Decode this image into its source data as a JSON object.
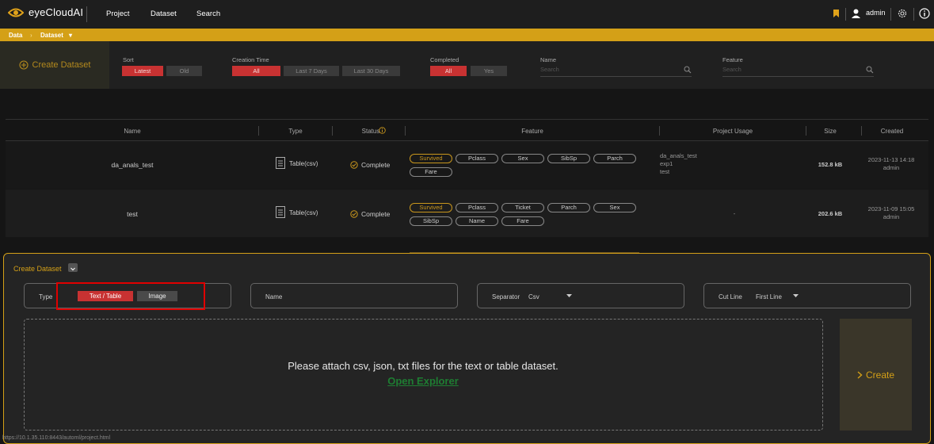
{
  "app": {
    "name": "eyeCloudAI"
  },
  "nav": {
    "project": "Project",
    "dataset": "Dataset",
    "search": "Search"
  },
  "user": {
    "name": "admin"
  },
  "breadcrumb": {
    "data": "Data",
    "sep": "›",
    "dataset": "Dataset",
    "caret": "▾"
  },
  "filters": {
    "create_label": "Create Dataset",
    "sort": {
      "label": "Sort",
      "options": [
        "Latest",
        "Old"
      ],
      "selected": "Latest"
    },
    "creation_time": {
      "label": "Creation Time",
      "options": [
        "All",
        "Last 7 Days",
        "Last 30 Days"
      ],
      "selected": "All"
    },
    "completed": {
      "label": "Completed",
      "options": [
        "All",
        "Yes"
      ],
      "selected": "All"
    },
    "name": {
      "label": "Name",
      "placeholder": "Search"
    },
    "feature": {
      "label": "Feature",
      "placeholder": "Search"
    }
  },
  "table": {
    "headers": [
      "Name",
      "Type",
      "Status",
      "Feature",
      "Project Usage",
      "Size",
      "Created"
    ],
    "rows": [
      {
        "name": "da_anals_test",
        "type": "Table(csv)",
        "status": "Complete",
        "features": [
          "Survived",
          "Pclass",
          "Sex",
          "SibSp",
          "Parch",
          "Fare"
        ],
        "target": "Survived",
        "usage": [
          "da_anals_test",
          "exp1",
          "test"
        ],
        "size": "152.8 kB",
        "created_date": "2023-11-13 14:18",
        "created_by": "admin"
      },
      {
        "name": "test",
        "type": "Table(csv)",
        "status": "Complete",
        "features": [
          "Survived",
          "Pclass",
          "Ticket",
          "Parch",
          "Sex",
          "SibSp",
          "Name",
          "Fare"
        ],
        "target": "Survived",
        "usage": [
          "-"
        ],
        "size": "202.6 kB",
        "created_date": "2023-11-09 15:05",
        "created_by": "admin"
      }
    ]
  },
  "panel": {
    "title": "Create Dataset",
    "type_label": "Type",
    "type_options": [
      "Text / Table",
      "Image"
    ],
    "type_selected": "Text / Table",
    "name_label": "Name",
    "separator_label": "Separator",
    "separator_value": "Csv",
    "cutline_label": "Cut Line",
    "cutline_value": "First Line",
    "drop_text": "Please attach csv, json, txt files for the text or table dataset.",
    "open_explorer": "Open Explorer",
    "create_button": "Create"
  },
  "status_url": "https://10.1.35.110:8443/automl/project.html",
  "colors": {
    "accent": "#d4a017",
    "selected": "#c83232",
    "link": "#1e7d32",
    "highlight_box": "#e00000"
  }
}
